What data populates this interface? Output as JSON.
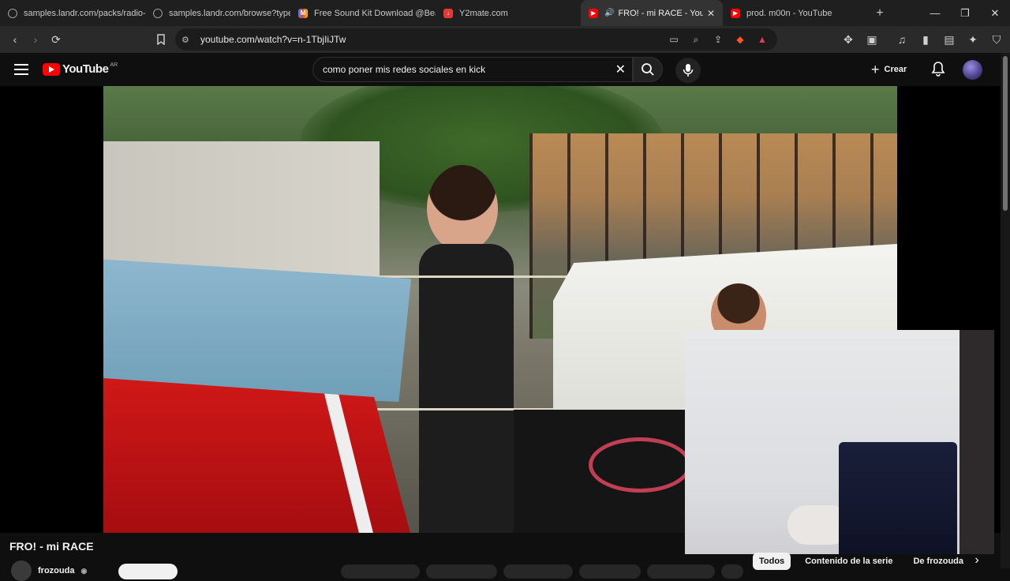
{
  "browser": {
    "tabs": [
      {
        "title": "samples.landr.com/packs/radio-",
        "favicon": "globe-icon",
        "color": "#9aa0a6"
      },
      {
        "title": "samples.landr.com/browse?type",
        "favicon": "globe-icon",
        "color": "#9aa0a6"
      },
      {
        "title": "Free Sound Kit Download @Beat",
        "favicon": "gmail-icon",
        "color": "#ea4335"
      },
      {
        "title": "Y2mate.com",
        "favicon": "download-icon",
        "color": "#e53935"
      },
      {
        "title": "FRO! - mi RACE - YouTube",
        "favicon": "youtube-icon",
        "color": "#ff0000",
        "active": true
      },
      {
        "title": "prod. m00n - YouTube",
        "favicon": "youtube-icon",
        "color": "#ff0000"
      }
    ],
    "url": "youtube.com/watch?v=n-1TbjIiJTw",
    "brave_badge": "99+"
  },
  "youtube": {
    "logo_text": "YouTube",
    "country_code": "AR",
    "search_query": "como poner mis redes sociales en kick",
    "create_label": "Crear"
  },
  "video": {
    "title": "FRO! - mi RACE",
    "channel_name": "frozouda"
  },
  "chips": [
    "Todos",
    "Contenido de la serie",
    "De frozouda"
  ],
  "colors": {
    "brand_red": "#ff0000",
    "background": "#0f0f0f"
  }
}
